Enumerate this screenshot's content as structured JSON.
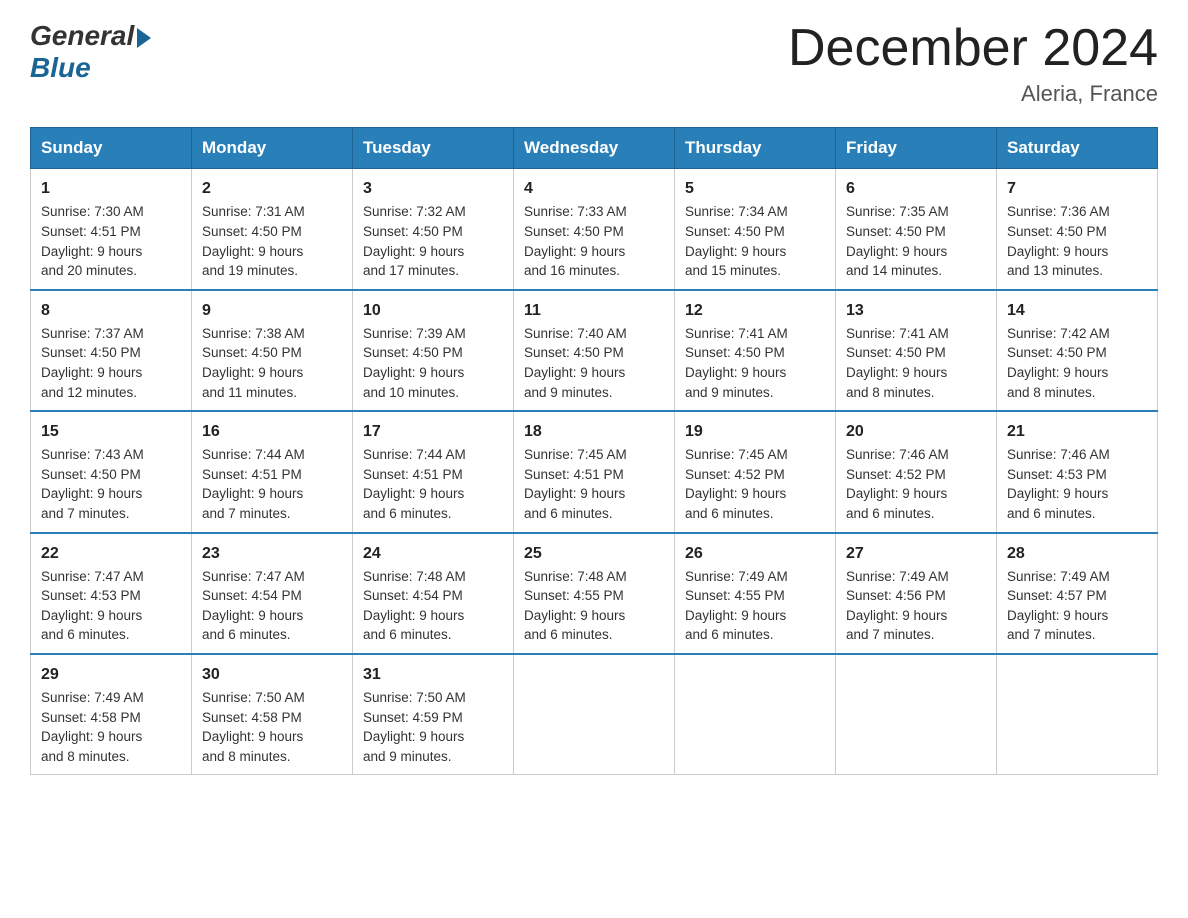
{
  "header": {
    "logo_general": "General",
    "logo_blue": "Blue",
    "title": "December 2024",
    "subtitle": "Aleria, France"
  },
  "weekdays": [
    "Sunday",
    "Monday",
    "Tuesday",
    "Wednesday",
    "Thursday",
    "Friday",
    "Saturday"
  ],
  "weeks": [
    [
      {
        "day": "1",
        "sunrise": "7:30 AM",
        "sunset": "4:51 PM",
        "daylight": "9 hours and 20 minutes."
      },
      {
        "day": "2",
        "sunrise": "7:31 AM",
        "sunset": "4:50 PM",
        "daylight": "9 hours and 19 minutes."
      },
      {
        "day": "3",
        "sunrise": "7:32 AM",
        "sunset": "4:50 PM",
        "daylight": "9 hours and 17 minutes."
      },
      {
        "day": "4",
        "sunrise": "7:33 AM",
        "sunset": "4:50 PM",
        "daylight": "9 hours and 16 minutes."
      },
      {
        "day": "5",
        "sunrise": "7:34 AM",
        "sunset": "4:50 PM",
        "daylight": "9 hours and 15 minutes."
      },
      {
        "day": "6",
        "sunrise": "7:35 AM",
        "sunset": "4:50 PM",
        "daylight": "9 hours and 14 minutes."
      },
      {
        "day": "7",
        "sunrise": "7:36 AM",
        "sunset": "4:50 PM",
        "daylight": "9 hours and 13 minutes."
      }
    ],
    [
      {
        "day": "8",
        "sunrise": "7:37 AM",
        "sunset": "4:50 PM",
        "daylight": "9 hours and 12 minutes."
      },
      {
        "day": "9",
        "sunrise": "7:38 AM",
        "sunset": "4:50 PM",
        "daylight": "9 hours and 11 minutes."
      },
      {
        "day": "10",
        "sunrise": "7:39 AM",
        "sunset": "4:50 PM",
        "daylight": "9 hours and 10 minutes."
      },
      {
        "day": "11",
        "sunrise": "7:40 AM",
        "sunset": "4:50 PM",
        "daylight": "9 hours and 9 minutes."
      },
      {
        "day": "12",
        "sunrise": "7:41 AM",
        "sunset": "4:50 PM",
        "daylight": "9 hours and 9 minutes."
      },
      {
        "day": "13",
        "sunrise": "7:41 AM",
        "sunset": "4:50 PM",
        "daylight": "9 hours and 8 minutes."
      },
      {
        "day": "14",
        "sunrise": "7:42 AM",
        "sunset": "4:50 PM",
        "daylight": "9 hours and 8 minutes."
      }
    ],
    [
      {
        "day": "15",
        "sunrise": "7:43 AM",
        "sunset": "4:50 PM",
        "daylight": "9 hours and 7 minutes."
      },
      {
        "day": "16",
        "sunrise": "7:44 AM",
        "sunset": "4:51 PM",
        "daylight": "9 hours and 7 minutes."
      },
      {
        "day": "17",
        "sunrise": "7:44 AM",
        "sunset": "4:51 PM",
        "daylight": "9 hours and 6 minutes."
      },
      {
        "day": "18",
        "sunrise": "7:45 AM",
        "sunset": "4:51 PM",
        "daylight": "9 hours and 6 minutes."
      },
      {
        "day": "19",
        "sunrise": "7:45 AM",
        "sunset": "4:52 PM",
        "daylight": "9 hours and 6 minutes."
      },
      {
        "day": "20",
        "sunrise": "7:46 AM",
        "sunset": "4:52 PM",
        "daylight": "9 hours and 6 minutes."
      },
      {
        "day": "21",
        "sunrise": "7:46 AM",
        "sunset": "4:53 PM",
        "daylight": "9 hours and 6 minutes."
      }
    ],
    [
      {
        "day": "22",
        "sunrise": "7:47 AM",
        "sunset": "4:53 PM",
        "daylight": "9 hours and 6 minutes."
      },
      {
        "day": "23",
        "sunrise": "7:47 AM",
        "sunset": "4:54 PM",
        "daylight": "9 hours and 6 minutes."
      },
      {
        "day": "24",
        "sunrise": "7:48 AM",
        "sunset": "4:54 PM",
        "daylight": "9 hours and 6 minutes."
      },
      {
        "day": "25",
        "sunrise": "7:48 AM",
        "sunset": "4:55 PM",
        "daylight": "9 hours and 6 minutes."
      },
      {
        "day": "26",
        "sunrise": "7:49 AM",
        "sunset": "4:55 PM",
        "daylight": "9 hours and 6 minutes."
      },
      {
        "day": "27",
        "sunrise": "7:49 AM",
        "sunset": "4:56 PM",
        "daylight": "9 hours and 7 minutes."
      },
      {
        "day": "28",
        "sunrise": "7:49 AM",
        "sunset": "4:57 PM",
        "daylight": "9 hours and 7 minutes."
      }
    ],
    [
      {
        "day": "29",
        "sunrise": "7:49 AM",
        "sunset": "4:58 PM",
        "daylight": "9 hours and 8 minutes."
      },
      {
        "day": "30",
        "sunrise": "7:50 AM",
        "sunset": "4:58 PM",
        "daylight": "9 hours and 8 minutes."
      },
      {
        "day": "31",
        "sunrise": "7:50 AM",
        "sunset": "4:59 PM",
        "daylight": "9 hours and 9 minutes."
      },
      null,
      null,
      null,
      null
    ]
  ],
  "labels": {
    "sunrise": "Sunrise:",
    "sunset": "Sunset:",
    "daylight": "Daylight:"
  }
}
